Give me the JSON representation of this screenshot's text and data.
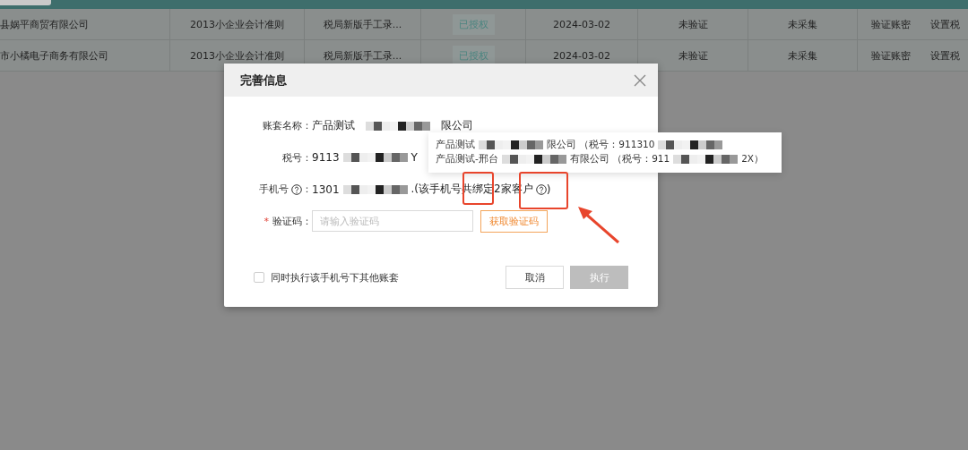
{
  "table": {
    "rows": [
      {
        "cells": [
          "县娲平商贸有限公司",
          "2013小企业会计准则",
          "税局新版手工录...",
          "已授权",
          "2024-03-02",
          "未验证",
          "未采集"
        ],
        "actions": [
          "验证账密",
          "设置税"
        ]
      },
      {
        "cells": [
          "市小橘电子商务有限公司",
          "2013小企业会计准则",
          "税局新版手工录...",
          "已授权",
          "2024-03-02",
          "未验证",
          "未采集"
        ],
        "actions": [
          "验证账密",
          "设置税"
        ]
      }
    ]
  },
  "dialog": {
    "title": "完善信息",
    "fields": [
      {
        "label": "账套名称：",
        "kind": "text",
        "segments": [
          {
            "kind": "text",
            "text": "产品测试"
          },
          {
            "kind": "redacted"
          },
          {
            "kind": "text",
            "text": "限公司"
          }
        ]
      },
      {
        "label": "税号：",
        "kind": "text",
        "segments": [
          {
            "kind": "text",
            "text": "9113"
          },
          {
            "kind": "redacted"
          },
          {
            "kind": "text",
            "text": "Y"
          }
        ]
      },
      {
        "label": "手机号",
        "help": true,
        "colon": "：",
        "kind": "text",
        "segments": [
          {
            "kind": "text",
            "text": "1301"
          },
          {
            "kind": "redacted"
          },
          {
            "kind": "text",
            "text": ".(该手机号共绑定2家客户"
          },
          {
            "kind": "help"
          },
          {
            "kind": "text",
            "text": ")"
          }
        ]
      },
      {
        "label": "验证码：",
        "required_mark": "*",
        "kind": "input",
        "placeholder": "请输入验证码",
        "button": "获取验证码"
      }
    ],
    "tooltip": [
      [
        {
          "kind": "text",
          "text": "产品测试"
        },
        {
          "kind": "redacted"
        },
        {
          "kind": "text",
          "text": "限公司 （税号：911310"
        },
        {
          "kind": "redacted"
        }
      ],
      [
        {
          "kind": "text",
          "text": "产品测试-邢台"
        },
        {
          "kind": "redacted"
        },
        {
          "kind": "text",
          "text": "有限公司 （税号：911"
        },
        {
          "kind": "redacted"
        },
        {
          "kind": "text",
          "text": "2X）"
        }
      ]
    ],
    "checkbox": {
      "label": "同时执行该手机号下其他账套",
      "checked": false
    },
    "buttons": [
      {
        "label": "取消",
        "disabled": false
      },
      {
        "label": "执行",
        "disabled": true
      }
    ]
  }
}
